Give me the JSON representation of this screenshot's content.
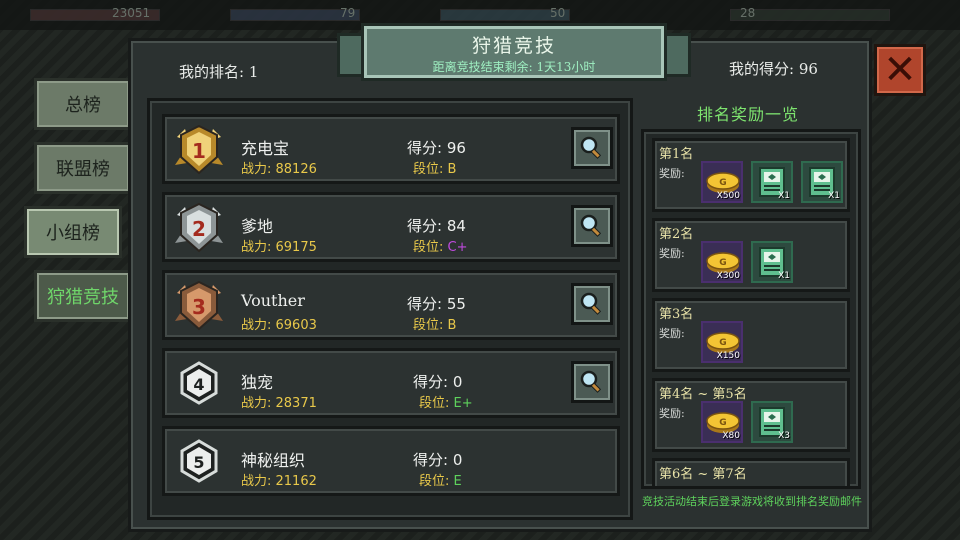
{
  "background": {
    "stat_values": [
      "23051",
      "79",
      "50",
      "28"
    ]
  },
  "side_tabs": [
    {
      "label": "总榜",
      "active": false
    },
    {
      "label": "联盟榜",
      "active": false
    },
    {
      "label": "小组榜",
      "active": true
    },
    {
      "label": "狩猎竞技",
      "active": false
    }
  ],
  "header": {
    "title": "狩猎竞技",
    "countdown": "距离竞技结束剩余: 1天13小时",
    "my_rank": "我的排名: 1",
    "my_score": "我的得分: 96"
  },
  "close_icon": "close-x-icon",
  "ranking": {
    "rows": [
      {
        "rank": "1",
        "badge": "gold-medal-1-icon",
        "name": "充电宝",
        "power": "战力: 88126",
        "score": "得分: 96",
        "tier_label": "段位: ",
        "tier": "B",
        "tier_color": "#e8c84a",
        "has_inspect": true
      },
      {
        "rank": "2",
        "badge": "silver-medal-2-icon",
        "name": "爹地",
        "power": "战力: 69175",
        "score": "得分: 84",
        "tier_label": "段位: ",
        "tier": "C+",
        "tier_color": "#c04adf",
        "has_inspect": true
      },
      {
        "rank": "3",
        "badge": "bronze-medal-3-icon",
        "name": "Vouther",
        "power": "战力: 69603",
        "score": "得分: 55",
        "tier_label": "段位: ",
        "tier": "B",
        "tier_color": "#e8c84a",
        "has_inspect": true
      },
      {
        "rank": "4",
        "badge": "hexagon-4-icon",
        "name": "独宠",
        "power": "战力: 28371",
        "score": "得分: 0",
        "tier_label": "段位: ",
        "tier": "E+",
        "tier_color": "#5ed25c",
        "has_inspect": true
      },
      {
        "rank": "5",
        "badge": "hexagon-5-icon",
        "name": "神秘组织",
        "power": "战力: 21162",
        "score": "得分: 0",
        "tier_label": "段位: ",
        "tier": "E",
        "tier_color": "#5ed25c",
        "has_inspect": false
      }
    ],
    "inspect_icon": "magnifier-icon"
  },
  "rewards": {
    "title": "排名奖励一览",
    "reward_label": "奖励:",
    "cards": [
      {
        "rank": "第1名",
        "items": [
          {
            "icon": "gold-coin-icon",
            "qty": "X500"
          },
          {
            "icon": "card-item-icon",
            "qty": "X1"
          },
          {
            "icon": "card-item-icon",
            "qty": "X1"
          }
        ]
      },
      {
        "rank": "第2名",
        "items": [
          {
            "icon": "gold-coin-icon",
            "qty": "X300"
          },
          {
            "icon": "card-item-icon",
            "qty": "X1"
          }
        ]
      },
      {
        "rank": "第3名",
        "items": [
          {
            "icon": "gold-coin-icon",
            "qty": "X150"
          }
        ]
      },
      {
        "rank": "第4名 ~ 第5名",
        "items": [
          {
            "icon": "gold-coin-icon",
            "qty": "X80"
          },
          {
            "icon": "card-item-icon",
            "qty": "X3"
          }
        ]
      },
      {
        "rank": "第6名 ~ 第7名",
        "items": []
      }
    ],
    "footnote": "竞技活动结束后登录游戏将收到排名奖励邮件"
  }
}
